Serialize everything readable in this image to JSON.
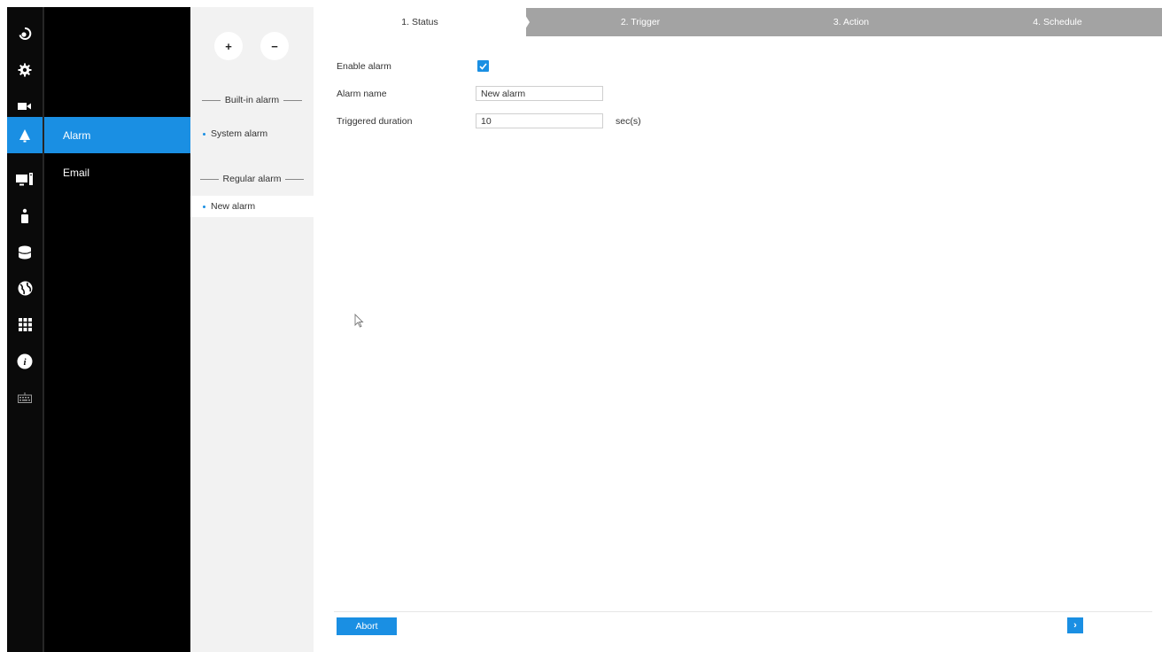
{
  "rail": {
    "items": [
      {
        "icon": "ptz-camera-icon",
        "active": false
      },
      {
        "icon": "gear-icon",
        "active": false
      },
      {
        "icon": "video-camera-icon",
        "active": false
      },
      {
        "icon": "bell-icon",
        "active": true
      },
      {
        "icon": "monitor-icon",
        "active": false
      },
      {
        "icon": "person-icon",
        "active": false
      },
      {
        "icon": "database-icon",
        "active": false
      },
      {
        "icon": "globe-icon",
        "active": false
      },
      {
        "icon": "apps-grid-icon",
        "active": false
      },
      {
        "icon": "info-icon",
        "active": false
      },
      {
        "icon": "keyboard-icon",
        "active": false
      }
    ],
    "active_color": "#1a8fe3"
  },
  "submenu": {
    "items": [
      {
        "label": "Alarm",
        "active": true
      },
      {
        "label": "Email",
        "active": false
      }
    ]
  },
  "alarm_list": {
    "add_label": "+",
    "remove_label": "−",
    "builtin_header": "Built-in alarm",
    "builtin_items": [
      "System alarm"
    ],
    "regular_header": "Regular alarm",
    "regular_items": [
      "New alarm"
    ],
    "selected": "New alarm"
  },
  "steps": [
    {
      "label": "1. Status",
      "active": true
    },
    {
      "label": "2. Trigger",
      "active": false
    },
    {
      "label": "3. Action",
      "active": false
    },
    {
      "label": "4. Schedule",
      "active": false
    }
  ],
  "form": {
    "enable_label": "Enable alarm",
    "enable_checked": true,
    "name_label": "Alarm name",
    "name_value": "New alarm",
    "duration_label": "Triggered duration",
    "duration_value": "10",
    "duration_unit": "sec(s)"
  },
  "footer": {
    "abort_label": "Abort",
    "next_label": "›"
  },
  "colors": {
    "accent": "#1a8fe3",
    "step_inactive": "#a3a3a3",
    "sidebar_bg": "#000000"
  }
}
